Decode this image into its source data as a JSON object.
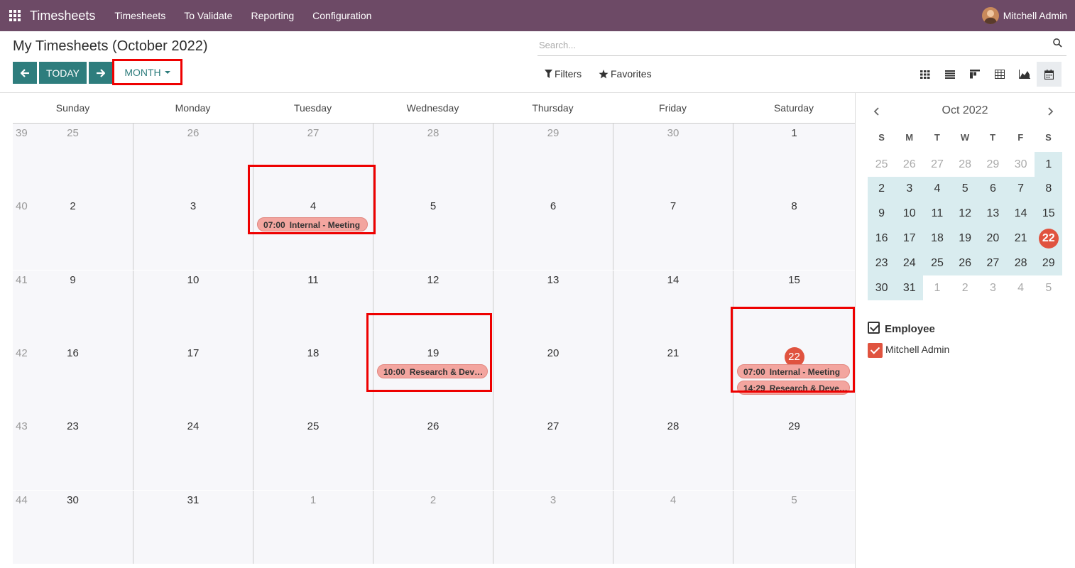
{
  "navbar": {
    "brand": "Timesheets",
    "menu": [
      "Timesheets",
      "To Validate",
      "Reporting",
      "Configuration"
    ],
    "user": "Mitchell Admin"
  },
  "control": {
    "title": "My Timesheets (October 2022)",
    "search_placeholder": "Search...",
    "today_label": "TODAY",
    "month_label": "MONTH",
    "filters_label": "Filters",
    "favorites_label": "Favorites",
    "views": [
      "grid-view-icon",
      "list-view-icon",
      "kanban-view-icon",
      "pivot-view-icon",
      "graph-view-icon",
      "calendar-view-icon"
    ]
  },
  "calendar": {
    "weekdays": [
      "Sunday",
      "Monday",
      "Tuesday",
      "Wednesday",
      "Thursday",
      "Friday",
      "Saturday"
    ],
    "weeks": [
      {
        "num": "39",
        "days": [
          {
            "d": "25",
            "o": true
          },
          {
            "d": "26",
            "o": true
          },
          {
            "d": "27",
            "o": true
          },
          {
            "d": "28",
            "o": true
          },
          {
            "d": "29",
            "o": true
          },
          {
            "d": "30",
            "o": true
          },
          {
            "d": "1",
            "o": false
          }
        ]
      },
      {
        "num": "40",
        "days": [
          {
            "d": "2",
            "o": false
          },
          {
            "d": "3",
            "o": false
          },
          {
            "d": "4",
            "o": false
          },
          {
            "d": "5",
            "o": false
          },
          {
            "d": "6",
            "o": false
          },
          {
            "d": "7",
            "o": false
          },
          {
            "d": "8",
            "o": false
          }
        ]
      },
      {
        "num": "41",
        "days": [
          {
            "d": "9",
            "o": false
          },
          {
            "d": "10",
            "o": false
          },
          {
            "d": "11",
            "o": false
          },
          {
            "d": "12",
            "o": false
          },
          {
            "d": "13",
            "o": false
          },
          {
            "d": "14",
            "o": false
          },
          {
            "d": "15",
            "o": false
          }
        ]
      },
      {
        "num": "42",
        "days": [
          {
            "d": "16",
            "o": false
          },
          {
            "d": "17",
            "o": false
          },
          {
            "d": "18",
            "o": false
          },
          {
            "d": "19",
            "o": false
          },
          {
            "d": "20",
            "o": false
          },
          {
            "d": "21",
            "o": false
          },
          {
            "d": "22",
            "o": false,
            "today": true
          }
        ]
      },
      {
        "num": "43",
        "days": [
          {
            "d": "23",
            "o": false
          },
          {
            "d": "24",
            "o": false
          },
          {
            "d": "25",
            "o": false
          },
          {
            "d": "26",
            "o": false
          },
          {
            "d": "27",
            "o": false
          },
          {
            "d": "28",
            "o": false
          },
          {
            "d": "29",
            "o": false
          }
        ]
      },
      {
        "num": "44",
        "days": [
          {
            "d": "30",
            "o": false
          },
          {
            "d": "31",
            "o": false
          },
          {
            "d": "1",
            "o": true
          },
          {
            "d": "2",
            "o": true
          },
          {
            "d": "3",
            "o": true
          },
          {
            "d": "4",
            "o": true
          },
          {
            "d": "5",
            "o": true
          }
        ]
      }
    ],
    "events": [
      {
        "week": 1,
        "day": 2,
        "slot": 0,
        "time": "07:00",
        "title": "Internal - Meeting"
      },
      {
        "week": 3,
        "day": 3,
        "slot": 0,
        "time": "10:00",
        "title": "Research & Development"
      },
      {
        "week": 3,
        "day": 6,
        "slot": 0,
        "time": "07:00",
        "title": "Internal - Meeting"
      },
      {
        "week": 3,
        "day": 6,
        "slot": 1,
        "time": "14:29",
        "title": "Research & Development"
      }
    ]
  },
  "sidebar": {
    "mini_title": "Oct 2022",
    "mini_headers": [
      "S",
      "M",
      "T",
      "W",
      "T",
      "F",
      "S"
    ],
    "mini_rows": [
      [
        "25",
        "26",
        "27",
        "28",
        "29",
        "30",
        "1"
      ],
      [
        "2",
        "3",
        "4",
        "5",
        "6",
        "7",
        "8"
      ],
      [
        "9",
        "10",
        "11",
        "12",
        "13",
        "14",
        "15"
      ],
      [
        "16",
        "17",
        "18",
        "19",
        "20",
        "21",
        "22"
      ],
      [
        "23",
        "24",
        "25",
        "26",
        "27",
        "28",
        "29"
      ],
      [
        "30",
        "31",
        "1",
        "2",
        "3",
        "4",
        "5"
      ]
    ],
    "filter_title": "Employee",
    "filter_item": "Mitchell Admin"
  }
}
